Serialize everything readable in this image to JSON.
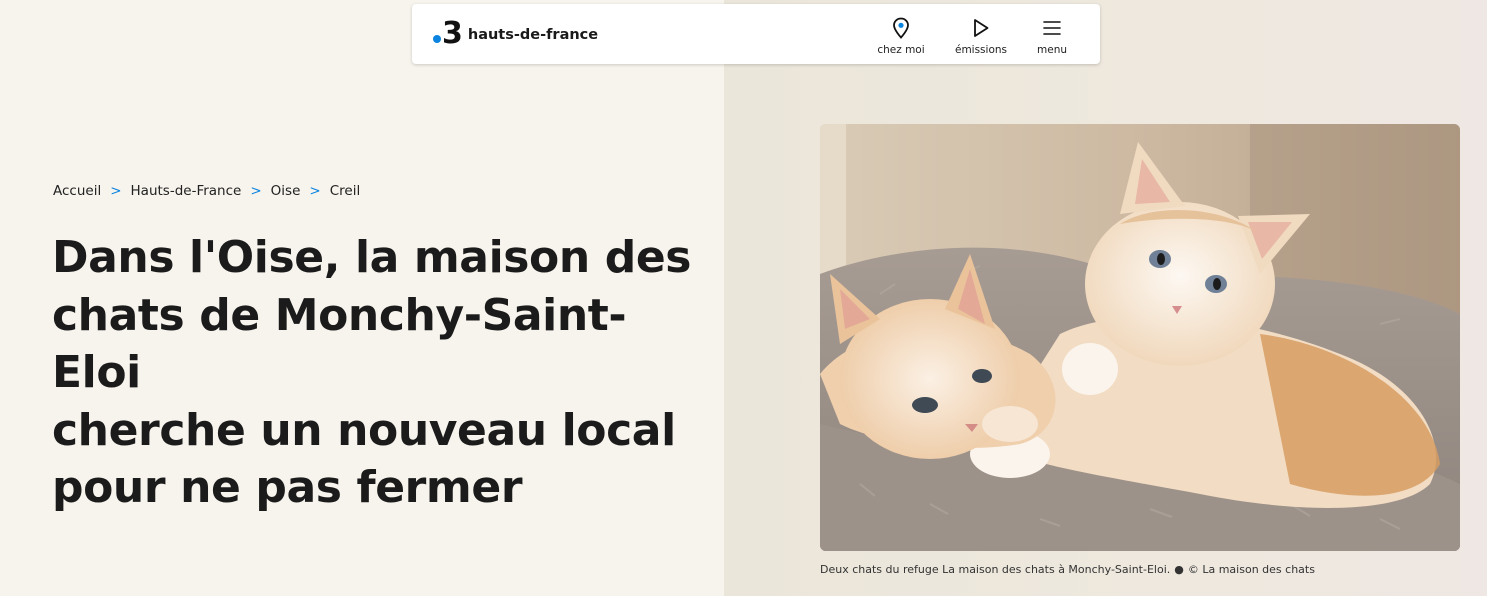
{
  "header": {
    "logo_number": "3",
    "logo_region": "hauts-de-france",
    "nav": {
      "chez_moi": "chez moi",
      "emissions": "émissions",
      "menu": "menu"
    }
  },
  "breadcrumb": {
    "items": [
      "Accueil",
      "Hauts-de-France",
      "Oise",
      "Creil"
    ],
    "separator": ">"
  },
  "article": {
    "title_lines": [
      "Dans l'Oise, la maison des",
      "chats de Monchy-Saint-Eloi",
      "cherche un nouveau local",
      "pour ne pas fermer"
    ],
    "photo_caption": "Deux chats du refuge La maison des chats à Monchy-Saint-Eloi.",
    "photo_dot": "●",
    "photo_credit": "© La maison des chats"
  },
  "colors": {
    "accent": "#0a84e0",
    "page_bg_left": "#f7f3ed",
    "page_bg_right": "#ebe6da",
    "text": "#1b1b1b"
  },
  "icons": {
    "chez_moi": "location-pin-icon",
    "emissions": "play-icon",
    "menu": "hamburger-icon"
  }
}
